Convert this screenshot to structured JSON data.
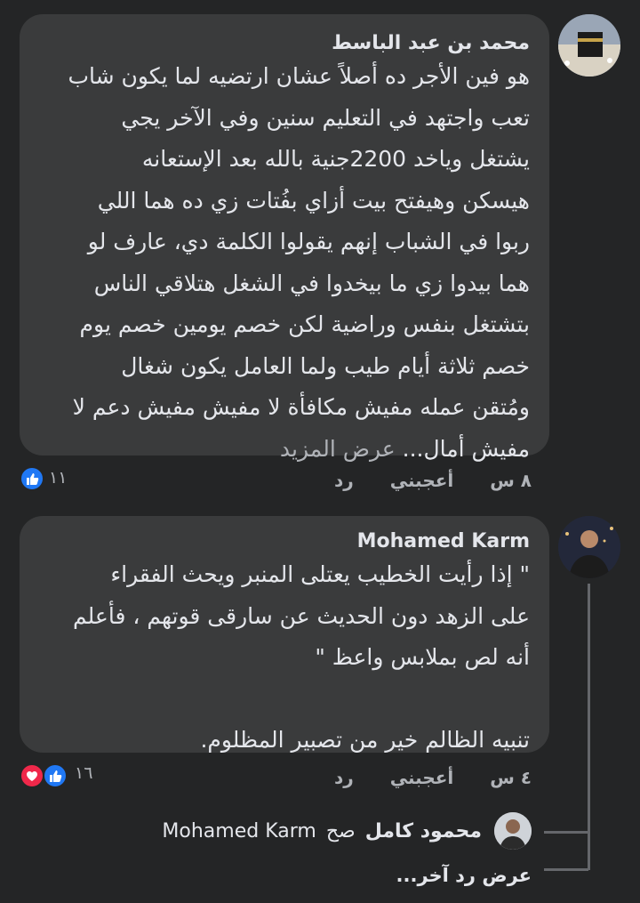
{
  "comments": [
    {
      "author": "محمد بن عبد الباسط",
      "lines": [
        "هو فين الأجر ده أصلاً عشان ارتضيه لما يكون شاب",
        "تعب واجتهد في التعليم سنين وفي الآخر يجي",
        "يشتغل وياخد 2200جنية بالله بعد الإستعانه",
        "هيسكن وهيفتح بيت أزاي بفُتات زي ده هما اللي",
        "ربوا في الشباب إنهم يقولوا الكلمة دي، عارف لو",
        "هما بيدوا زي ما بيخدوا في الشغل هتلاقي الناس",
        "بتشتغل بنفس وراضية لكن خصم يومين خصم يوم",
        "خصم ثلاثة أيام طيب ولما العامل يكون شغال",
        "ومُتقن عمله مفيش مكافأة لا مفيش مفيش دعم لا"
      ],
      "last_line": "مفيش أمال...",
      "see_more": "عرض المزيد",
      "time": "٨ س",
      "like": "أعجبني",
      "reply": "رد",
      "reaction_count": "١١",
      "reaction_icons": [
        "like-icon"
      ],
      "colors": {
        "like": "#2078f4"
      }
    },
    {
      "author": "Mohamed Karm",
      "lines": [
        "\" إذا رأيت الخطيب يعتلى المنبر ويحث الفقراء",
        "على الزهد دون الحديث عن سارقى قوتهم ، فأعلم",
        "أنه لص بملابس واعظ \"",
        "",
        "تنبيه الظالم خير من تصبير المظلوم."
      ],
      "time": "٤ س",
      "like": "أعجبني",
      "reply": "رد",
      "reaction_count": "١٦",
      "reaction_icons": [
        "like-icon",
        "love-icon"
      ],
      "colors": {
        "like": "#2078f4",
        "love": "#f0284a"
      }
    }
  ],
  "reply_preview": {
    "author": "محمود كامل",
    "verb": "صح",
    "mention": "Mohamed Karm"
  },
  "view_more_replies": "عرض رد آخر..."
}
